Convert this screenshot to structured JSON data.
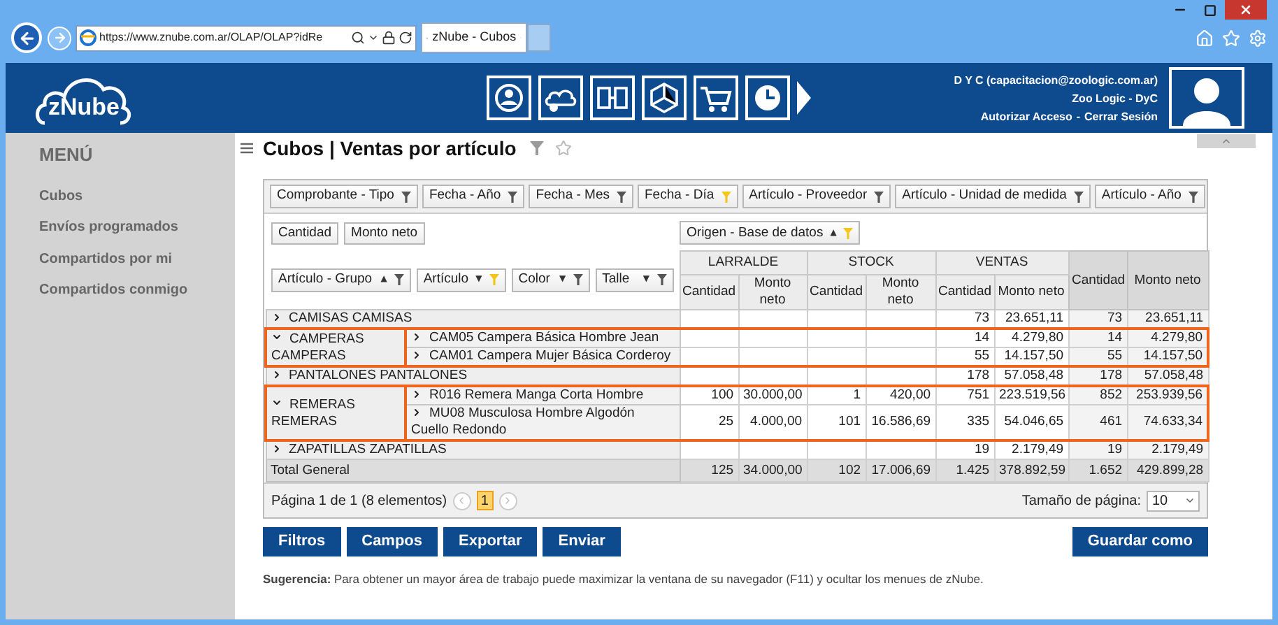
{
  "browser": {
    "url": "https://www.znube.com.ar/OLAP/OLAP?idRe",
    "tab": "zNube - Cubos"
  },
  "header": {
    "logo": "zNube",
    "user": "D Y C (capacitacion@zoologic.com.ar)",
    "company": "Zoo Logic - DyC",
    "links": [
      "Autorizar Acceso",
      "Cerrar Sesión"
    ],
    "separator": "-"
  },
  "sidebar": {
    "title": "MENÚ",
    "items": [
      "Cubos",
      "Envíos programados",
      "Compartidos por mi",
      "Compartidos conmigo"
    ]
  },
  "page_title": "Cubos | Ventas por artículo",
  "filter_fields": [
    {
      "label": "Comprobante - Tipo",
      "filtered": false
    },
    {
      "label": "Fecha - Año",
      "filtered": false
    },
    {
      "label": "Fecha - Mes",
      "filtered": false
    },
    {
      "label": "Fecha - Día",
      "filtered": true
    },
    {
      "label": "Artículo - Proveedor",
      "filtered": false
    },
    {
      "label": "Artículo - Unidad de medida",
      "filtered": false
    },
    {
      "label": "Artículo - Año",
      "filtered": false
    }
  ],
  "data_fields": [
    "Cantidad",
    "Monto neto"
  ],
  "column_field": {
    "label": "Origen - Base de datos",
    "sort": "▲",
    "filtered": true
  },
  "row_fields": [
    {
      "label": "Artículo - Grupo",
      "sort": "▲",
      "filtered": false
    },
    {
      "label": "Artículo",
      "sort": "▼",
      "filtered": true
    },
    {
      "label": "Color",
      "sort": "▼",
      "filtered": false
    },
    {
      "label": "Talle",
      "sort": "▼",
      "filtered": false
    }
  ],
  "columns": {
    "groups": [
      {
        "label": "LARRALDE",
        "measures": [
          "Cantidad",
          "Monto neto"
        ]
      },
      {
        "label": "STOCK",
        "measures": [
          "Cantidad",
          "Monto neto"
        ]
      },
      {
        "label": "VENTAS",
        "measures": [
          "Cantidad",
          "Monto neto"
        ]
      }
    ],
    "totals": [
      "Cantidad",
      "Monto neto"
    ]
  },
  "rows": [
    {
      "label": "CAMISAS CAMISAS",
      "expanded": false,
      "highlighted": false,
      "values": {
        "ventas_cantidad": "73",
        "ventas_monto": "23.651,11",
        "total_cantidad": "73",
        "total_monto": "23.651,11"
      }
    },
    {
      "label": "CAMPERAS CAMPERAS",
      "expanded": true,
      "highlighted": true,
      "children": [
        {
          "label": "CAM05 Campera Básica Hombre Jean",
          "expanded": false,
          "values": {
            "ventas_cantidad": "14",
            "ventas_monto": "4.279,80",
            "total_cantidad": "14",
            "total_monto": "4.279,80"
          }
        },
        {
          "label": "CAM01 Campera Mujer Básica Corderoy",
          "expanded": false,
          "values": {
            "ventas_cantidad": "55",
            "ventas_monto": "14.157,50",
            "total_cantidad": "55",
            "total_monto": "14.157,50"
          }
        }
      ]
    },
    {
      "label": "PANTALONES PANTALONES",
      "expanded": false,
      "highlighted": false,
      "values": {
        "ventas_cantidad": "178",
        "ventas_monto": "57.058,48",
        "total_cantidad": "178",
        "total_monto": "57.058,48"
      }
    },
    {
      "label": "REMERAS REMERAS",
      "expanded": true,
      "highlighted": true,
      "children": [
        {
          "label": "R016 Remera Manga Corta Hombre",
          "expanded": false,
          "values": {
            "larralde_cantidad": "100",
            "larralde_monto": "30.000,00",
            "stock_cantidad": "1",
            "stock_monto": "420,00",
            "ventas_cantidad": "751",
            "ventas_monto": "223.519,56",
            "total_cantidad": "852",
            "total_monto": "253.939,56"
          }
        },
        {
          "label": "MU08 Musculosa Hombre Algodón Cuello Redondo",
          "expanded": false,
          "values": {
            "larralde_cantidad": "25",
            "larralde_monto": "4.000,00",
            "stock_cantidad": "101",
            "stock_monto": "16.586,69",
            "ventas_cantidad": "335",
            "ventas_monto": "54.046,65",
            "total_cantidad": "461",
            "total_monto": "74.633,34"
          }
        }
      ]
    },
    {
      "label": "ZAPATILLAS ZAPATILLAS",
      "expanded": false,
      "highlighted": false,
      "values": {
        "ventas_cantidad": "19",
        "ventas_monto": "2.179,49",
        "total_cantidad": "19",
        "total_monto": "2.179,49"
      }
    }
  ],
  "total": {
    "label": "Total General",
    "values": {
      "larralde_cantidad": "125",
      "larralde_monto": "34.000,00",
      "stock_cantidad": "102",
      "stock_monto": "17.006,69",
      "ventas_cantidad": "1.425",
      "ventas_monto": "378.892,59",
      "total_cantidad": "1.652",
      "total_monto": "429.899,28"
    }
  },
  "pager": {
    "summary": "Página 1 de 1 (8 elementos)",
    "pages": [
      {
        "label": "1",
        "selected": true
      }
    ],
    "size_label": "Tamaño de página:",
    "size": "10"
  },
  "buttons": [
    "Filtros",
    "Campos",
    "Exportar",
    "Enviar"
  ],
  "save_button": "Guardar como",
  "hint": "**Sugerencia:** Para obtener un mayor área de trabajo puede maximizar la ventana de su navegador (F11) y ocultar los menues de zNube."
}
